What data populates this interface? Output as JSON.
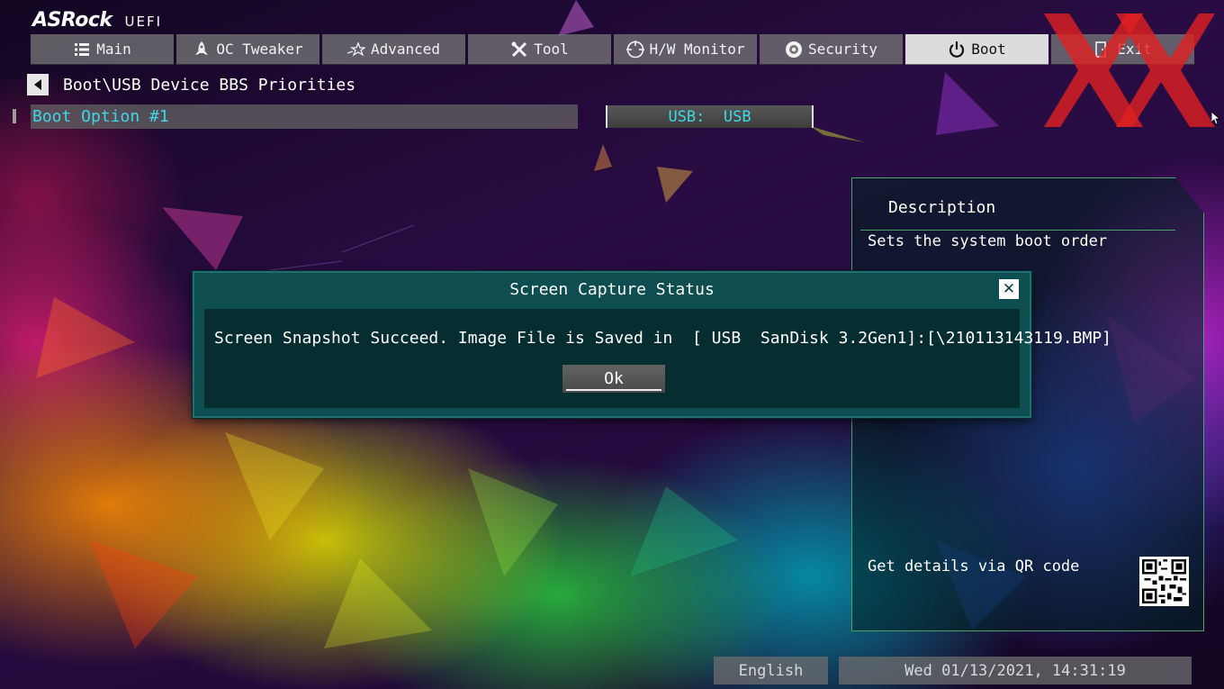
{
  "header": {
    "brand": "ASRock",
    "uefi": "UEFI"
  },
  "tabs": [
    {
      "label": "Main",
      "icon": "list-icon"
    },
    {
      "label": "OC Tweaker",
      "icon": "rocket-icon"
    },
    {
      "label": "Advanced",
      "icon": "star-icon"
    },
    {
      "label": "Tool",
      "icon": "tools-icon"
    },
    {
      "label": "H/W Monitor",
      "icon": "monitor-icon"
    },
    {
      "label": "Security",
      "icon": "shield-icon"
    },
    {
      "label": "Boot",
      "icon": "power-icon",
      "active": true
    },
    {
      "label": "Exit",
      "icon": "exit-icon"
    }
  ],
  "breadcrumb": "Boot\\USB Device BBS Priorities",
  "boot_option": {
    "label": "Boot Option #1",
    "value": "USB:  USB"
  },
  "description": {
    "title": "Description",
    "text": "Sets the system boot order",
    "qr_text": "Get details via QR code"
  },
  "dialog": {
    "title": "Screen Capture Status",
    "message": "Screen Snapshot Succeed. Image File is Saved in  [ USB  SanDisk 3.2Gen1]:[\\210113143119.BMP]",
    "ok_label": "Ok"
  },
  "footer": {
    "language": "English",
    "datetime": "Wed 01/13/2021, 14:31:19"
  },
  "colors": {
    "accent_cyan": "#3fd6e8",
    "dialog_bg": "#0e4d50",
    "panel_border": "#4ea06a",
    "active_tab": "#dcdcdc"
  }
}
